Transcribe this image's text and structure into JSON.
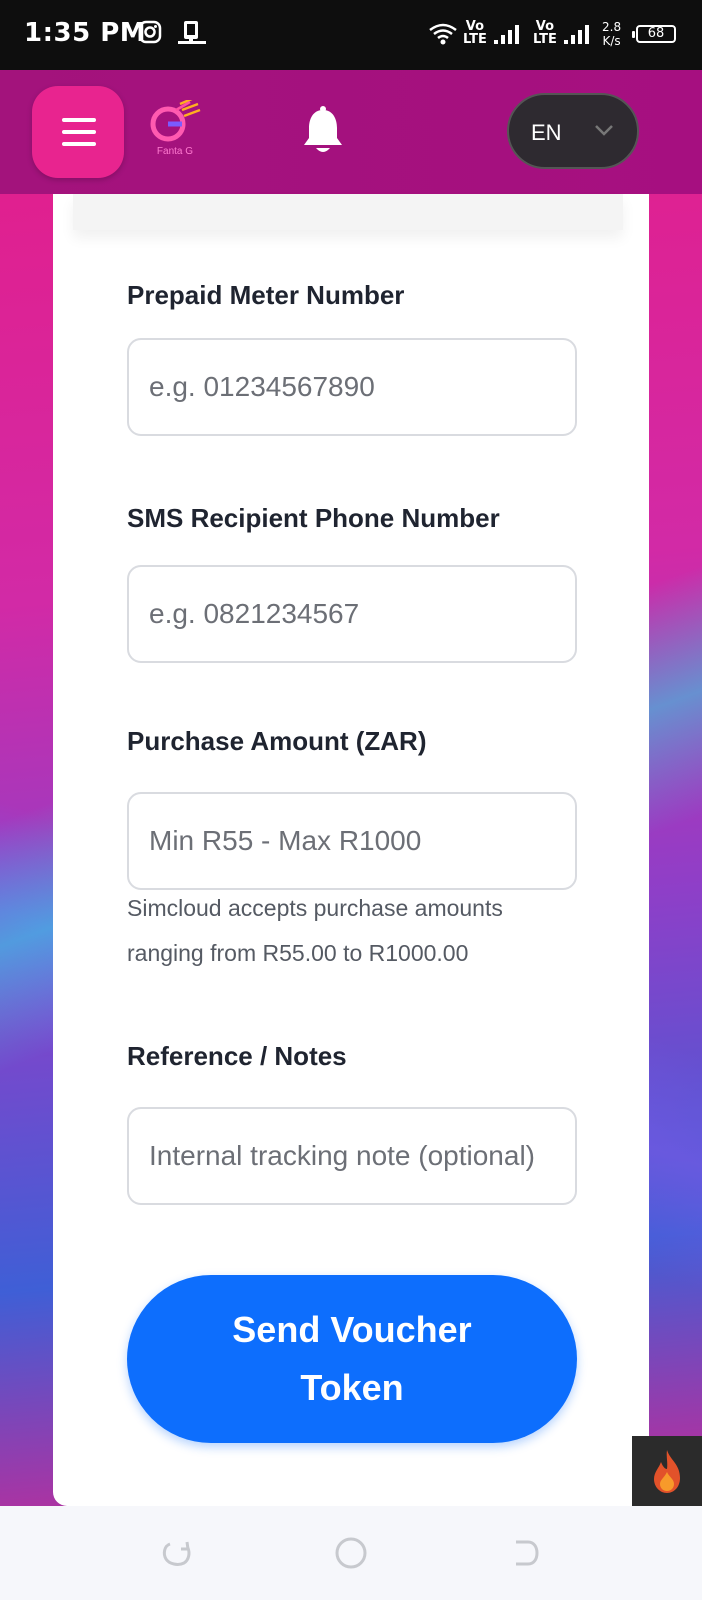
{
  "status_bar": {
    "time": "1:35 PM",
    "icons": [
      "instagram-icon",
      "device-icon",
      "wifi-icon",
      "signal-icon"
    ],
    "net1_top": "Vo",
    "net1_bottom": "LTE",
    "net2_top": "Vo",
    "net2_bottom": "LTE",
    "speed_value": "2.8",
    "speed_unit": "K/s",
    "battery": "68"
  },
  "header": {
    "logo_text": "Fanta G",
    "language": "EN",
    "colors": {
      "header": "#a3137c",
      "menu_button": "#e8248f"
    }
  },
  "form": {
    "meter": {
      "label": "Prepaid Meter Number",
      "placeholder": "e.g. 01234567890",
      "value": ""
    },
    "phone": {
      "label": "SMS Recipient Phone Number",
      "placeholder": "e.g. 0821234567",
      "value": ""
    },
    "amount": {
      "label": "Purchase Amount (ZAR)",
      "placeholder": "Min R55 - Max R1000",
      "value": "",
      "helper": "Simcloud accepts purchase amounts ranging from R55.00 to R1000.00"
    },
    "notes": {
      "label": "Reference / Notes",
      "placeholder": "Internal tracking note (optional)",
      "value": ""
    },
    "submit_label": "Send Voucher Token",
    "accent": "#0d6efd"
  },
  "floating_button": {
    "icon": "fire-icon"
  },
  "nav_bar": {
    "icons": [
      "back-icon",
      "home-icon",
      "recents-icon"
    ]
  }
}
